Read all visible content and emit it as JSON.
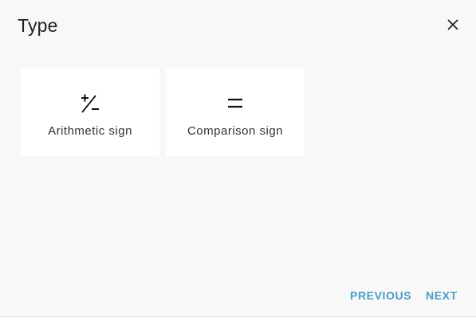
{
  "dialog": {
    "title": "Type"
  },
  "options": [
    {
      "label": "Arithmetic sign",
      "icon": "plus-minus-icon"
    },
    {
      "label": "Comparison sign",
      "icon": "equals-icon"
    }
  ],
  "footer": {
    "previous_label": "PREVIOUS",
    "next_label": "NEXT"
  },
  "colors": {
    "background": "#f8f8f8",
    "card": "#ffffff",
    "accent": "#4a9cc7",
    "text": "#222222"
  }
}
